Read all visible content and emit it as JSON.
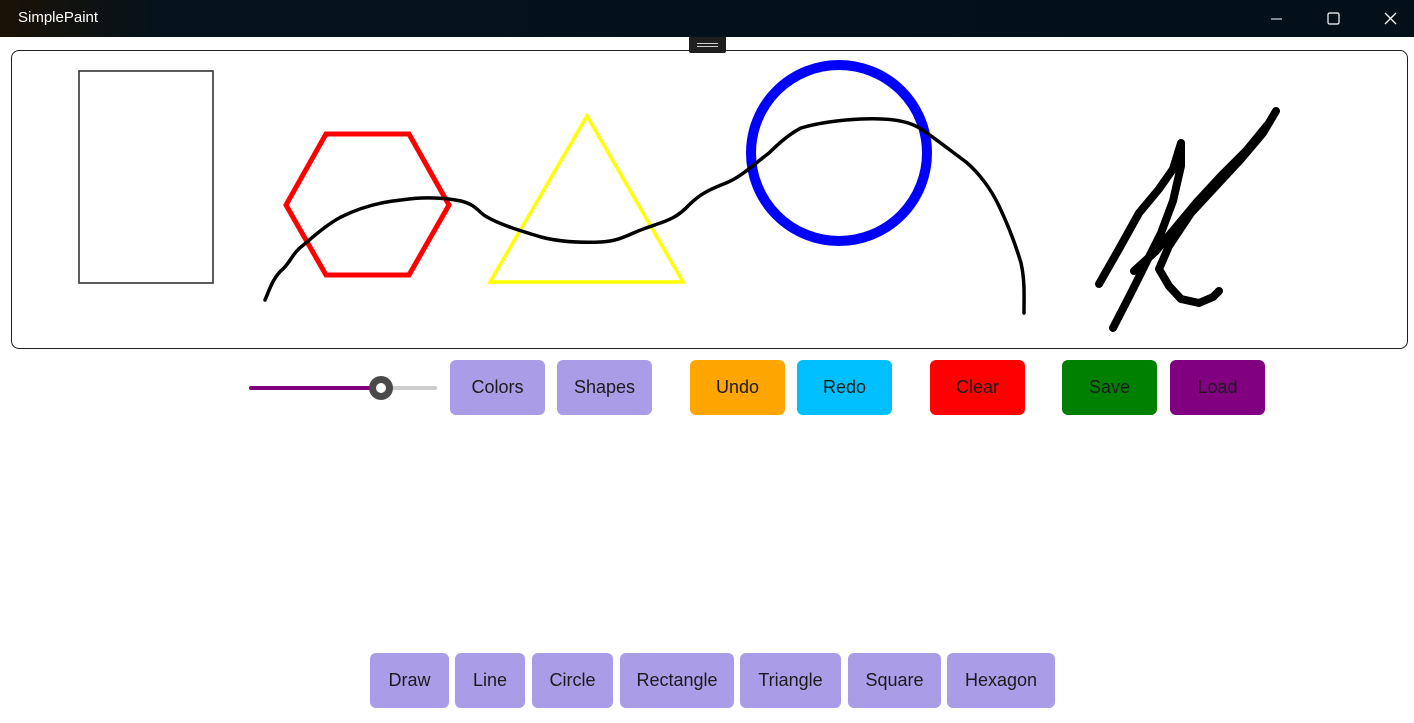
{
  "window": {
    "title": "SimplePaint",
    "controls": {
      "minimize_icon": "minimize-icon",
      "maximize_icon": "maximize-icon",
      "close_icon": "close-icon"
    }
  },
  "canvas": {
    "shapes": [
      {
        "kind": "rectangle",
        "stroke": "#333333"
      },
      {
        "kind": "hexagon",
        "stroke": "#ff0000"
      },
      {
        "kind": "triangle",
        "stroke": "#ffff00"
      },
      {
        "kind": "circle",
        "stroke": "#0000ff"
      },
      {
        "kind": "freehand-line",
        "stroke": "#000000"
      },
      {
        "kind": "freehand-scribble",
        "stroke": "#000000"
      }
    ]
  },
  "toolbar": {
    "brush_size_percent": 70,
    "slider_fill_color": "#800080",
    "colors_label": "Colors",
    "shapes_label": "Shapes",
    "undo_label": "Undo",
    "redo_label": "Redo",
    "clear_label": "Clear",
    "save_label": "Save",
    "load_label": "Load",
    "colors": {
      "lavender": "#ab9ce8",
      "undo": "#ffa500",
      "redo": "#00bfff",
      "clear": "#ff0000",
      "save": "#008000",
      "load": "#800080"
    }
  },
  "shape_tools": {
    "items": [
      {
        "label": "Draw"
      },
      {
        "label": "Line"
      },
      {
        "label": "Circle"
      },
      {
        "label": "Rectangle"
      },
      {
        "label": "Triangle"
      },
      {
        "label": "Square"
      },
      {
        "label": "Hexagon"
      }
    ]
  }
}
